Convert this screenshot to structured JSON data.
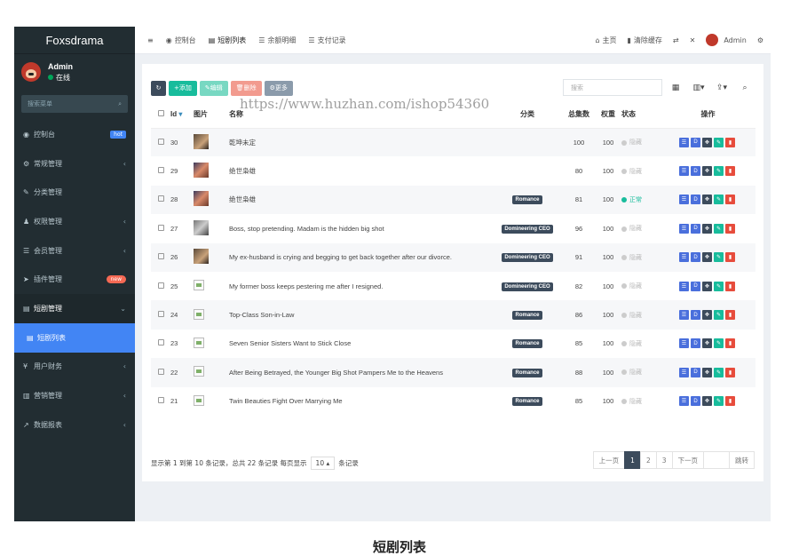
{
  "brand": "Foxsdrama",
  "user": {
    "name": "Admin",
    "status": "在线"
  },
  "sidebar": {
    "search_placeholder": "搜索菜单",
    "items": [
      {
        "icon": "dashboard-icon",
        "glyph": "◉",
        "label": "控制台",
        "badge": "hot"
      },
      {
        "icon": "gears-icon",
        "glyph": "⚙",
        "label": "常规管理",
        "arrow": "‹"
      },
      {
        "icon": "leaf-icon",
        "glyph": "✎",
        "label": "分类管理"
      },
      {
        "icon": "users-icon",
        "glyph": "♟",
        "label": "权限管理",
        "arrow": "‹"
      },
      {
        "icon": "list-icon",
        "glyph": "☰",
        "label": "会员管理",
        "arrow": "‹"
      },
      {
        "icon": "rocket-icon",
        "glyph": "➤",
        "label": "插件管理",
        "badge": "new"
      },
      {
        "icon": "file-icon",
        "glyph": "▤",
        "label": "短剧管理",
        "arrow": "⌄"
      },
      {
        "icon": "file-icon",
        "glyph": "▤",
        "label": "短剧列表"
      },
      {
        "icon": "yen-icon",
        "glyph": "¥",
        "label": "用户财务",
        "arrow": "‹"
      },
      {
        "icon": "bar-chart-icon",
        "glyph": "▥",
        "label": "营销管理",
        "arrow": "‹"
      },
      {
        "icon": "line-chart-icon",
        "glyph": "↗",
        "label": "数据报表",
        "arrow": "‹"
      }
    ]
  },
  "topbar": {
    "menu_toggle": "≡",
    "tabs": [
      "控制台",
      "短剧列表",
      "余额明细",
      "支付记录"
    ],
    "right": [
      "主页",
      "清除缓存"
    ],
    "admin": "Admin"
  },
  "toolbar": {
    "refresh": "↻",
    "add": "+添加",
    "edit": "✎编辑",
    "delete": "🗑删除",
    "more": "⚙更多",
    "search_placeholder": "搜索"
  },
  "table": {
    "headers": [
      "Id",
      "图片",
      "名称",
      "分类",
      "总集数",
      "权重",
      "状态",
      "操作"
    ],
    "status_off": "隐藏",
    "status_on": "正常",
    "rows": [
      {
        "id": "30",
        "img": "thumb-a",
        "name": "乾坤未定",
        "cat": "",
        "total": "100",
        "weight": "100",
        "on": false
      },
      {
        "id": "29",
        "img": "thumb-b",
        "name": "绝世枭雄",
        "cat": "",
        "total": "80",
        "weight": "100",
        "on": false
      },
      {
        "id": "28",
        "img": "thumb-b",
        "name": "绝世枭雄",
        "cat": "Romance",
        "total": "81",
        "weight": "100",
        "on": true
      },
      {
        "id": "27",
        "img": "thumb-c",
        "name": "Boss, stop pretending. Madam is the hidden big shot",
        "cat": "Domineering CEO",
        "total": "96",
        "weight": "100",
        "on": false
      },
      {
        "id": "26",
        "img": "thumb-a",
        "name": "My ex-husband is crying and begging to get back together after our divorce.",
        "cat": "Domineering CEO",
        "total": "91",
        "weight": "100",
        "on": false
      },
      {
        "id": "25",
        "img": "broken",
        "name": "My former boss keeps pestering me after I resigned.",
        "cat": "Domineering CEO",
        "total": "82",
        "weight": "100",
        "on": false
      },
      {
        "id": "24",
        "img": "broken",
        "name": "Top-Class Son-in-Law",
        "cat": "Romance",
        "total": "86",
        "weight": "100",
        "on": false
      },
      {
        "id": "23",
        "img": "broken",
        "name": "Seven Senior Sisters Want to Stick Close",
        "cat": "Romance",
        "total": "85",
        "weight": "100",
        "on": false
      },
      {
        "id": "22",
        "img": "broken",
        "name": "After Being Betrayed, the Younger Big Shot Pampers Me to the Heavens",
        "cat": "Romance",
        "total": "88",
        "weight": "100",
        "on": false
      },
      {
        "id": "21",
        "img": "broken",
        "name": "Twin Beauties Fight Over Marrying Me",
        "cat": "Romance",
        "total": "85",
        "weight": "100",
        "on": false
      }
    ]
  },
  "pagination": {
    "summary_prefix": "显示第 1 到第 10 条记录，总共 22 条记录 每页显示",
    "per_page": "10",
    "summary_suffix": "条记录",
    "prev": "上一页",
    "pages": [
      "1",
      "2",
      "3"
    ],
    "next": "下一页",
    "go": "跳转"
  },
  "watermark": "https://www.huzhan.com/ishop54360",
  "caption": "短剧列表"
}
